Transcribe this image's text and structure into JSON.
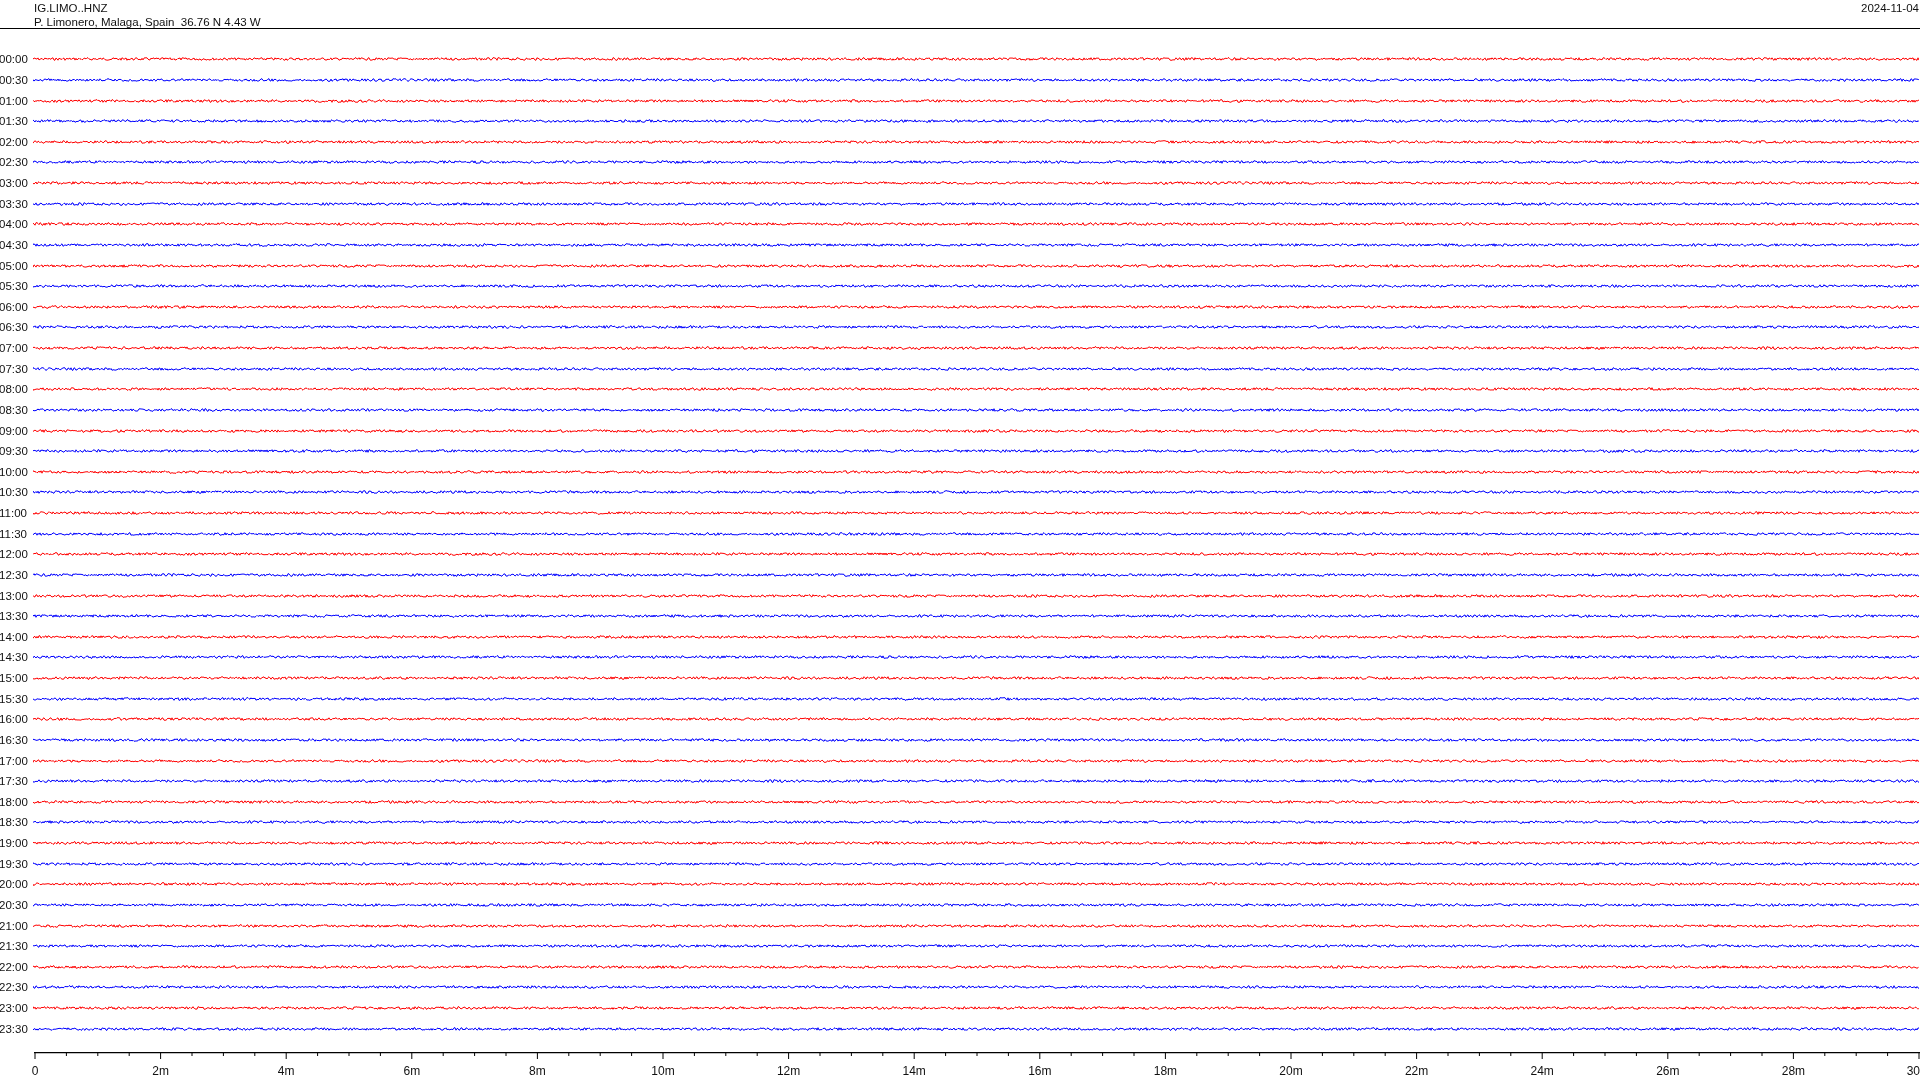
{
  "header": {
    "station": "IG.LIMO..HNZ",
    "location": "P. Limonero, Malaga, Spain  36.76 N 4.43 W",
    "date": "2024-11-04"
  },
  "rows": [
    {
      "time": "00:00",
      "color": "#ff0000"
    },
    {
      "time": "00:30",
      "color": "#0000ff"
    },
    {
      "time": "01:00",
      "color": "#ff0000"
    },
    {
      "time": "01:30",
      "color": "#0000ff"
    },
    {
      "time": "02:00",
      "color": "#ff0000"
    },
    {
      "time": "02:30",
      "color": "#0000ff"
    },
    {
      "time": "03:00",
      "color": "#ff0000"
    },
    {
      "time": "03:30",
      "color": "#0000ff"
    },
    {
      "time": "04:00",
      "color": "#ff0000"
    },
    {
      "time": "04:30",
      "color": "#0000ff"
    },
    {
      "time": "05:00",
      "color": "#ff0000"
    },
    {
      "time": "05:30",
      "color": "#0000ff"
    },
    {
      "time": "06:00",
      "color": "#ff0000"
    },
    {
      "time": "06:30",
      "color": "#0000ff"
    },
    {
      "time": "07:00",
      "color": "#ff0000"
    },
    {
      "time": "07:30",
      "color": "#0000ff"
    },
    {
      "time": "08:00",
      "color": "#ff0000"
    },
    {
      "time": "08:30",
      "color": "#0000ff"
    },
    {
      "time": "09:00",
      "color": "#ff0000"
    },
    {
      "time": "09:30",
      "color": "#0000ff"
    },
    {
      "time": "10:00",
      "color": "#ff0000"
    },
    {
      "time": "10:30",
      "color": "#0000ff"
    },
    {
      "time": "11:00",
      "color": "#ff0000"
    },
    {
      "time": "11:30",
      "color": "#0000ff"
    },
    {
      "time": "12:00",
      "color": "#ff0000"
    },
    {
      "time": "12:30",
      "color": "#0000ff"
    },
    {
      "time": "13:00",
      "color": "#ff0000"
    },
    {
      "time": "13:30",
      "color": "#0000ff"
    },
    {
      "time": "14:00",
      "color": "#ff0000"
    },
    {
      "time": "14:30",
      "color": "#0000ff"
    },
    {
      "time": "15:00",
      "color": "#ff0000"
    },
    {
      "time": "15:30",
      "color": "#0000ff"
    },
    {
      "time": "16:00",
      "color": "#ff0000"
    },
    {
      "time": "16:30",
      "color": "#0000ff"
    },
    {
      "time": "17:00",
      "color": "#ff0000"
    },
    {
      "time": "17:30",
      "color": "#0000ff"
    },
    {
      "time": "18:00",
      "color": "#ff0000"
    },
    {
      "time": "18:30",
      "color": "#0000ff"
    },
    {
      "time": "19:00",
      "color": "#ff0000"
    },
    {
      "time": "19:30",
      "color": "#0000ff"
    },
    {
      "time": "20:00",
      "color": "#ff0000"
    },
    {
      "time": "20:30",
      "color": "#0000ff"
    },
    {
      "time": "21:00",
      "color": "#ff0000"
    },
    {
      "time": "21:30",
      "color": "#0000ff"
    },
    {
      "time": "22:00",
      "color": "#ff0000"
    },
    {
      "time": "22:30",
      "color": "#0000ff"
    },
    {
      "time": "23:00",
      "color": "#ff0000"
    },
    {
      "time": "23:30",
      "color": "#0000ff"
    }
  ],
  "x_axis": {
    "labels": [
      "0",
      "2m",
      "4m",
      "6m",
      "8m",
      "10m",
      "12m",
      "14m",
      "16m",
      "18m",
      "20m",
      "22m",
      "24m",
      "26m",
      "28m",
      "30"
    ]
  }
}
